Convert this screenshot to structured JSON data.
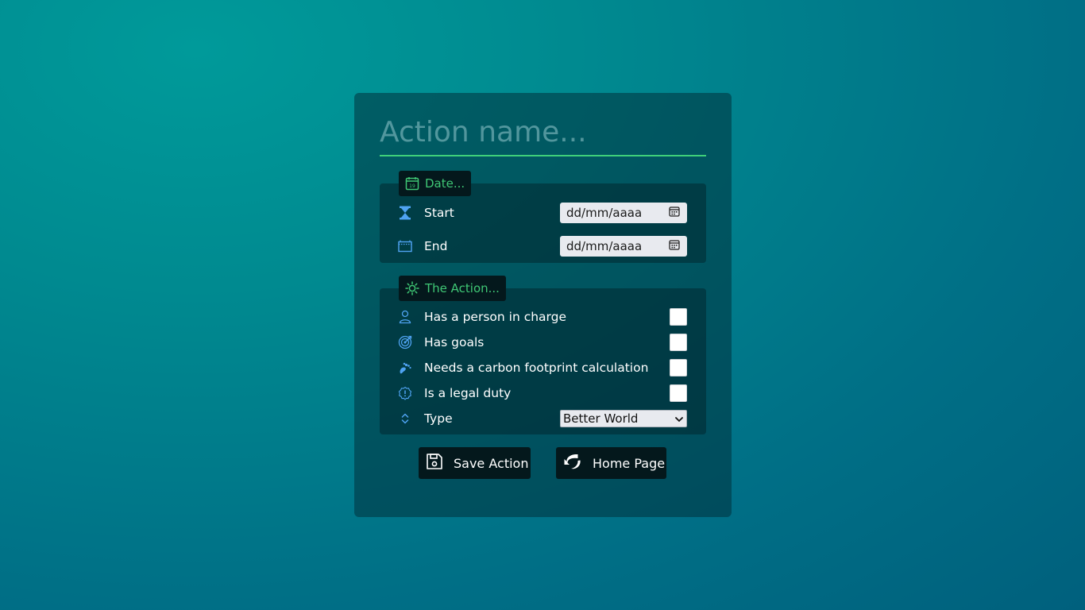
{
  "form": {
    "name_placeholder": "Action name..."
  },
  "date_section": {
    "legend_icon": "calendar-icon",
    "legend_label": "Date...",
    "start": {
      "icon": "hourglass-icon",
      "label": "Start",
      "value": "dd/mm/aaaa"
    },
    "end": {
      "icon": "calendar-range-icon",
      "label": "End",
      "value": "dd/mm/aaaa"
    }
  },
  "action_section": {
    "legend_icon": "sun-icon",
    "legend_label": "The Action...",
    "options": [
      {
        "icon": "person-icon",
        "label": "Has a person in charge",
        "checked": false
      },
      {
        "icon": "target-icon",
        "label": "Has goals",
        "checked": false
      },
      {
        "icon": "footprint-icon",
        "label": "Needs a carbon footprint calculation",
        "checked": false
      },
      {
        "icon": "alert-badge-icon",
        "label": "Is a legal duty",
        "checked": false
      }
    ],
    "type": {
      "icon": "sort-arrows-icon",
      "label": "Type",
      "selected": "Better World"
    }
  },
  "buttons": {
    "save_label": "Save Action",
    "home_label": "Home Page"
  },
  "colors": {
    "accent_green": "#3fc775",
    "icon_blue": "#4fa3f2",
    "button_bg": "#04181c"
  }
}
